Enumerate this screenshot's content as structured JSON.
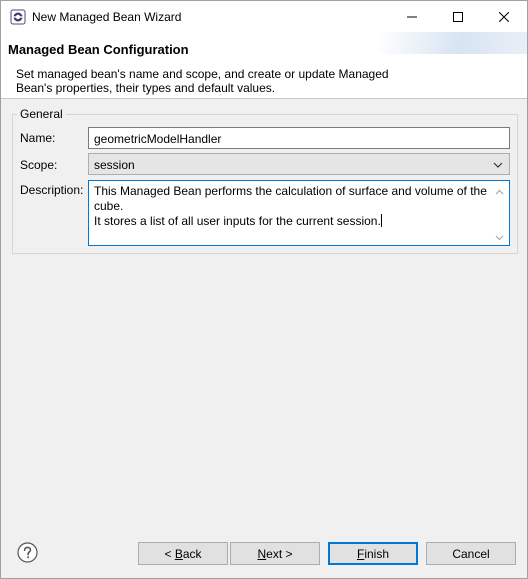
{
  "window": {
    "title": "New Managed Bean Wizard",
    "icon": "eclipse-wizard-icon"
  },
  "banner": {
    "title": "Managed Bean Configuration",
    "description_line1": "Set managed bean's name and scope, and create or update Managed",
    "description_line2": "Bean's properties, their types and default values."
  },
  "group": {
    "legend": "General",
    "name_label": "Name:",
    "name_value": "geometricModelHandler",
    "scope_label": "Scope:",
    "scope_value": "session",
    "description_label": "Description:",
    "description_lines": [
      "This Managed Bean performs the calculation of surface and volume of the",
      "cube.",
      "It stores a list of all user inputs for the current session."
    ]
  },
  "buttons": {
    "back": {
      "prefix": "< ",
      "mnemonic": "B",
      "rest": "ack"
    },
    "next": {
      "mnemonic": "N",
      "rest": "ext >"
    },
    "finish": {
      "mnemonic": "F",
      "rest": "inish"
    },
    "cancel": "Cancel"
  },
  "colors": {
    "focus_border": "#0078d7",
    "window_bg": "#f0f0f0",
    "button_bg": "#e1e1e1"
  }
}
